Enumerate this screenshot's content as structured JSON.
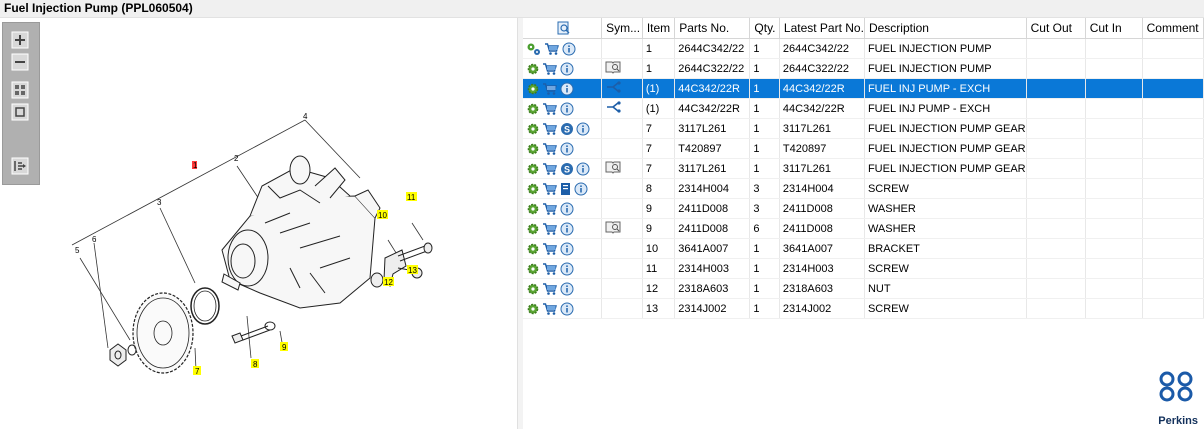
{
  "window": {
    "title": "Fuel Injection Pump (PPL060504)"
  },
  "colors": {
    "selected_row": "#0a78d7",
    "callout_yellow": "#ffff00",
    "callout_red": "#ff3b3b",
    "brand": "#1b5aa8"
  },
  "diagram": {
    "callouts": [
      "1",
      "2",
      "3",
      "4",
      "5",
      "6",
      "7",
      "8",
      "9",
      "10",
      "11",
      "12",
      "13"
    ]
  },
  "table": {
    "columns": [
      "",
      "Sym...",
      "Item",
      "Parts No.",
      "Qty.",
      "Latest Part No.",
      "Description",
      "Cut Out",
      "Cut In",
      "Comment"
    ],
    "rows": [
      {
        "icons": [
          "gears",
          "cart",
          "info"
        ],
        "sym": "",
        "item": "1",
        "part": "2644C342/22",
        "qty": "1",
        "latest": "2644C342/22",
        "desc": "FUEL INJECTION PUMP",
        "cutout": "",
        "cutin": "",
        "comment": ""
      },
      {
        "icons": [
          "gear",
          "cart",
          "info"
        ],
        "sym": "book",
        "item": "1",
        "part": "2644C322/22",
        "qty": "1",
        "latest": "2644C322/22",
        "desc": "FUEL INJECTION PUMP",
        "cutout": "",
        "cutin": "",
        "comment": ""
      },
      {
        "icons": [
          "gear",
          "cart",
          "info"
        ],
        "sym": "branch",
        "item": "(1)",
        "part": "44C342/22R",
        "qty": "1",
        "latest": "44C342/22R",
        "desc": "FUEL INJ PUMP - EXCH",
        "cutout": "",
        "cutin": "",
        "comment": "",
        "selected": true
      },
      {
        "icons": [
          "gear",
          "cart",
          "info"
        ],
        "sym": "branch",
        "item": "(1)",
        "part": "44C342/22R",
        "qty": "1",
        "latest": "44C342/22R",
        "desc": "FUEL INJ PUMP - EXCH",
        "cutout": "",
        "cutin": "",
        "comment": ""
      },
      {
        "icons": [
          "gear",
          "cart",
          "s",
          "info"
        ],
        "sym": "",
        "item": "7",
        "part": "3117L261",
        "qty": "1",
        "latest": "3117L261",
        "desc": "FUEL INJECTION PUMP GEAR",
        "cutout": "",
        "cutin": "",
        "comment": ""
      },
      {
        "icons": [
          "gear",
          "cart",
          "info"
        ],
        "sym": "",
        "item": "7",
        "part": "T420897",
        "qty": "1",
        "latest": "T420897",
        "desc": "FUEL INJECTION PUMP GEAR",
        "cutout": "",
        "cutin": "",
        "comment": ""
      },
      {
        "icons": [
          "gear",
          "cart",
          "s",
          "info"
        ],
        "sym": "book",
        "item": "7",
        "part": "3117L261",
        "qty": "1",
        "latest": "3117L261",
        "desc": "FUEL INJECTION PUMP GEAR",
        "cutout": "",
        "cutin": "",
        "comment": ""
      },
      {
        "icons": [
          "gear",
          "cart",
          "doc",
          "info"
        ],
        "sym": "",
        "item": "8",
        "part": "2314H004",
        "qty": "3",
        "latest": "2314H004",
        "desc": "SCREW",
        "cutout": "",
        "cutin": "",
        "comment": ""
      },
      {
        "icons": [
          "gear",
          "cart",
          "info"
        ],
        "sym": "",
        "item": "9",
        "part": "2411D008",
        "qty": "3",
        "latest": "2411D008",
        "desc": "WASHER",
        "cutout": "",
        "cutin": "",
        "comment": ""
      },
      {
        "icons": [
          "gear",
          "cart",
          "info"
        ],
        "sym": "book",
        "item": "9",
        "part": "2411D008",
        "qty": "6",
        "latest": "2411D008",
        "desc": "WASHER",
        "cutout": "",
        "cutin": "",
        "comment": ""
      },
      {
        "icons": [
          "gear",
          "cart",
          "info"
        ],
        "sym": "",
        "item": "10",
        "part": "3641A007",
        "qty": "1",
        "latest": "3641A007",
        "desc": "BRACKET",
        "cutout": "",
        "cutin": "",
        "comment": ""
      },
      {
        "icons": [
          "gear",
          "cart",
          "info"
        ],
        "sym": "",
        "item": "11",
        "part": "2314H003",
        "qty": "1",
        "latest": "2314H003",
        "desc": "SCREW",
        "cutout": "",
        "cutin": "",
        "comment": ""
      },
      {
        "icons": [
          "gear",
          "cart",
          "info"
        ],
        "sym": "",
        "item": "12",
        "part": "2318A603",
        "qty": "1",
        "latest": "2318A603",
        "desc": "NUT",
        "cutout": "",
        "cutin": "",
        "comment": ""
      },
      {
        "icons": [
          "gear",
          "cart",
          "info"
        ],
        "sym": "",
        "item": "13",
        "part": "2314J002",
        "qty": "1",
        "latest": "2314J002",
        "desc": "SCREW",
        "cutout": "",
        "cutin": "",
        "comment": ""
      }
    ]
  },
  "brand": {
    "name": "Perkins"
  }
}
